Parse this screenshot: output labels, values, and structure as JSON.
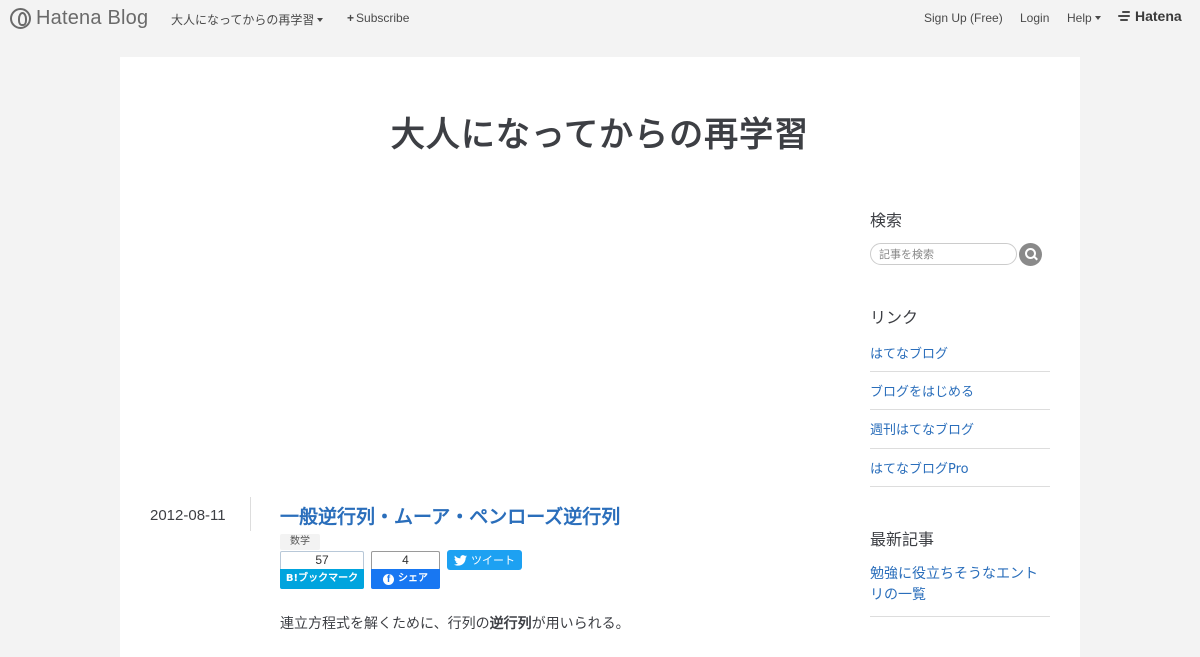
{
  "global_header": {
    "logo_text": "Hatena Blog",
    "blog_title": "大人になってからの再学習",
    "subscribe": "Subscribe",
    "signup": "Sign Up (Free)",
    "login": "Login",
    "help": "Help",
    "hatena": "Hatena"
  },
  "blog": {
    "title": "大人になってからの再学習"
  },
  "entry": {
    "date": "2012-08-11",
    "title": "一般逆行列・ムーア・ペンローズ逆行列",
    "category": "数学",
    "hatebu": {
      "count": "57",
      "label": "B!ブックマーク"
    },
    "facebook": {
      "count": "4",
      "label": "シェア"
    },
    "twitter": {
      "label": "ツイート"
    },
    "body": {
      "before": "連立方程式を解くために、行列の",
      "bold": "逆行列",
      "after": "が用いられる。"
    }
  },
  "sidebar": {
    "search": {
      "title": "検索",
      "placeholder": "記事を検索"
    },
    "links": {
      "title": "リンク",
      "items": [
        "はてなブログ",
        "ブログをはじめる",
        "週刊はてなブログ",
        "はてなブログPro"
      ]
    },
    "recent": {
      "title": "最新記事",
      "items": [
        "勉強に役立ちそうなエントリの一覧"
      ]
    }
  },
  "colors": {
    "background": "#f3f3f3",
    "link": "#2a6ebb",
    "hatebu": "#00a4de",
    "facebook": "#1877f2",
    "twitter": "#1da1f2"
  },
  "icons": [
    "hatena-blog-logo-icon",
    "caret-down-icon",
    "plus-icon",
    "hatena-logo-icon",
    "search-icon",
    "facebook-icon",
    "twitter-bird-icon"
  ]
}
